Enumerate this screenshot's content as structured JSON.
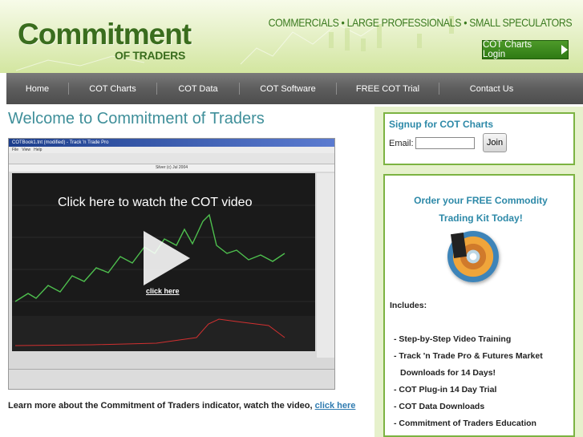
{
  "header": {
    "logo_main": "Commitment",
    "logo_sub": "OF TRADERS",
    "tagline": "COMMERCIALS • LARGE PROFESSIONALS • SMALL SPECULATORS",
    "login_button": "COT Charts Login"
  },
  "nav": {
    "items": [
      {
        "label": "Home"
      },
      {
        "label": "COT Charts"
      },
      {
        "label": "COT Data"
      },
      {
        "label": "COT Software"
      },
      {
        "label": "FREE COT Trial"
      },
      {
        "label": "Contact Us"
      }
    ]
  },
  "main": {
    "title": "Welcome to Commitment of Traders",
    "video": {
      "caption": "Click here to watch the COT video",
      "link": "click here",
      "window_title": "COTBook1.tnt (modified) - Track 'n Trade Pro",
      "chart_title": "Silver (c) Jul 2004"
    },
    "learn_text": "Learn more about the Commitment of Traders indicator, watch the video,",
    "learn_link": "click here"
  },
  "sidebar": {
    "signup": {
      "title": "Signup for COT Charts",
      "email_label": "Email:",
      "email_value": "",
      "join_button": "Join"
    },
    "order": {
      "title_line1": "Order your FREE Commodity",
      "title_line2": "Trading Kit Today!",
      "includes_label": "Includes:",
      "items": [
        "- Step-by-Step Video Training",
        "- Track 'n Trade Pro & Futures Market",
        "Downloads for 14 Days!",
        "- COT Plug-in 14 Day Trial",
        "- COT Data Downloads",
        "- Commitment of Traders Education"
      ]
    }
  },
  "colors": {
    "brand_green": "#3a6d1e",
    "accent_teal": "#3f8f9a",
    "box_border": "#7cb342",
    "nav_gray": "#5d5d5d"
  }
}
